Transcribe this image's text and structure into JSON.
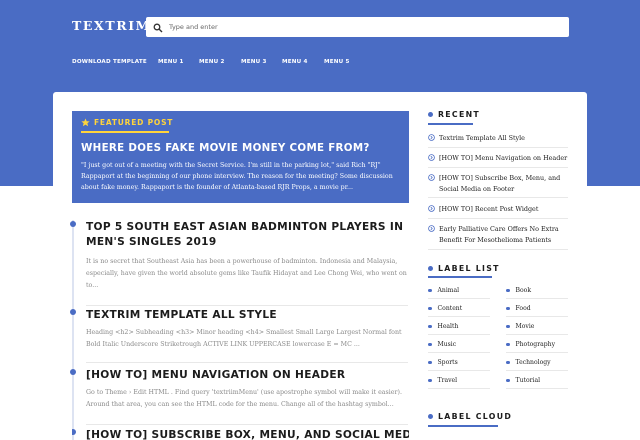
{
  "site": {
    "logo": "TEXTRIM"
  },
  "search": {
    "placeholder": "Type and enter"
  },
  "nav": [
    "DOWNLOAD TEMPLATE",
    "MENU 1",
    "MENU 2",
    "MENU 3",
    "MENU 4",
    "MENU 5"
  ],
  "featured": {
    "badge": "FEATURED POST",
    "title": "WHERE DOES FAKE MOVIE MONEY COME FROM?",
    "excerpt": "\"I just got out of a meeting with the Secret Service. I'm still in the parking lot,\" said Rich \"RJ\" Rappaport at the beginning of our phone interview. The reason for the meeting? Some discussion about fake money. Rappaport is the founder of Atlanta-based RJR Props, a movie pr..."
  },
  "posts": [
    {
      "title": "TOP 5 SOUTH EAST ASIAN BADMINTON PLAYERS IN MEN'S SINGLES 2019",
      "excerpt": "It is no secret that Southeast Asia has been a powerhouse of badminton. Indonesia and Malaysia, especially, have given the world absolute gems like Taufik Hidayat and Lee Chong Wei, who went on to..."
    },
    {
      "title": "TEXTRIM TEMPLATE ALL STYLE",
      "excerpt": "Heading <h2> Subheading <h3> Minor heading <h4> Smallest Small Large Largest Normal font Bold Italic Underscore Striketrough ACTIVE LINK UPPERCASE lowercase E = MC ..."
    },
    {
      "title": "[HOW TO] MENU NAVIGATION ON HEADER",
      "excerpt": "Go to Theme › Edit HTML . Find query 'textriimMenu' (use apostrophe symbol will make it easier). Around that area, you can see the HTML code for the menu. Change all of the hashtag symbol..."
    },
    {
      "title": "[HOW TO] SUBSCRIBE BOX, MENU, AND SOCIAL MEDIA",
      "excerpt": ""
    }
  ],
  "sidebar": {
    "recent": {
      "heading": "RECENT",
      "items": [
        "Textrim Template All Style",
        "[HOW TO] Menu Navigation on Header",
        "[HOW TO] Subscribe Box, Menu, and Social Media on Footer",
        "[HOW TO] Recent Post Widget",
        "Early Palliative Care Offers No Extra Benefit For Mesothelioma Patients"
      ]
    },
    "label_list": {
      "heading": "LABEL LIST",
      "items": [
        "Animal",
        "Book",
        "Content",
        "Food",
        "Health",
        "Movie",
        "Music",
        "Photography",
        "Sports",
        "Technology",
        "Travel",
        "Tutorial"
      ]
    },
    "label_cloud": {
      "heading": "LABEL CLOUD"
    }
  },
  "colors": {
    "brand": "#4a6cc4",
    "accent": "#ffd43b"
  }
}
